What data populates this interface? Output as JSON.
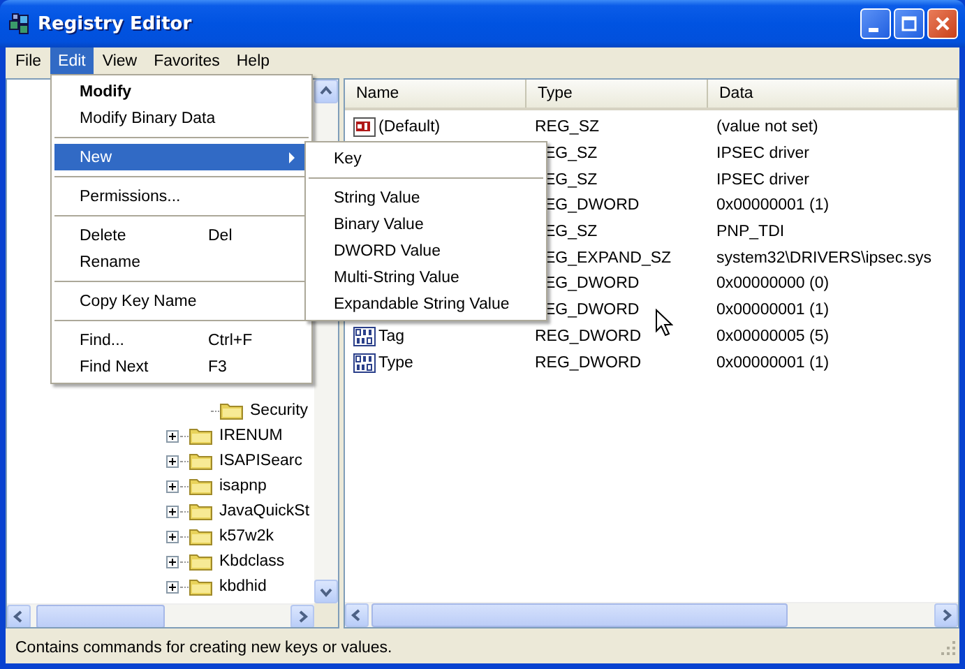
{
  "window": {
    "title": "Registry Editor"
  },
  "menu_bar": [
    {
      "label": "File",
      "selected": false
    },
    {
      "label": "Edit",
      "selected": true
    },
    {
      "label": "View",
      "selected": false
    },
    {
      "label": "Favorites",
      "selected": false
    },
    {
      "label": "Help",
      "selected": false
    }
  ],
  "edit_menu": [
    {
      "kind": "item",
      "label": "Modify",
      "default": true,
      "selected": false,
      "submenu": false
    },
    {
      "kind": "item",
      "label": "Modify Binary Data",
      "default": false,
      "selected": false,
      "submenu": false
    },
    {
      "kind": "separator"
    },
    {
      "kind": "item",
      "label": "New",
      "default": false,
      "selected": true,
      "submenu": true
    },
    {
      "kind": "separator"
    },
    {
      "kind": "item",
      "label": "Permissions...",
      "default": false,
      "selected": false,
      "submenu": false
    },
    {
      "kind": "separator"
    },
    {
      "kind": "item",
      "label": "Delete",
      "shortcut": "Del",
      "default": false,
      "selected": false,
      "submenu": false
    },
    {
      "kind": "item",
      "label": "Rename",
      "default": false,
      "selected": false,
      "submenu": false
    },
    {
      "kind": "separator"
    },
    {
      "kind": "item",
      "label": "Copy Key Name",
      "default": false,
      "selected": false,
      "submenu": false
    },
    {
      "kind": "separator"
    },
    {
      "kind": "item",
      "label": "Find...",
      "shortcut": "Ctrl+F",
      "default": false,
      "selected": false,
      "submenu": false
    },
    {
      "kind": "item",
      "label": "Find Next",
      "shortcut": "F3",
      "default": false,
      "selected": false,
      "submenu": false
    }
  ],
  "new_submenu": [
    {
      "kind": "item",
      "label": "Key"
    },
    {
      "kind": "separator"
    },
    {
      "kind": "item",
      "label": "String Value"
    },
    {
      "kind": "item",
      "label": "Binary Value"
    },
    {
      "kind": "item",
      "label": "DWORD Value"
    },
    {
      "kind": "item",
      "label": "Multi-String Value"
    },
    {
      "kind": "item",
      "label": "Expandable String Value"
    }
  ],
  "tree": {
    "open_branch_children": [
      {
        "label": "Security"
      }
    ],
    "items": [
      {
        "label": "IRENUM",
        "expanded": false
      },
      {
        "label": "ISAPISearc",
        "expanded": false
      },
      {
        "label": "isapnp",
        "expanded": false
      },
      {
        "label": "JavaQuickSt",
        "expanded": false
      },
      {
        "label": "k57w2k",
        "expanded": false
      },
      {
        "label": "Kbdclass",
        "expanded": false
      },
      {
        "label": "kbdhid",
        "expanded": false
      }
    ]
  },
  "values": {
    "columns": [
      "Name",
      "Type",
      "Data"
    ],
    "rows": [
      {
        "kind": "string",
        "name": "(Default)",
        "type": "REG_SZ",
        "data": "(value not set)"
      },
      {
        "type": "EG_SZ",
        "data": "IPSEC driver"
      },
      {
        "type": "EG_SZ",
        "data": "IPSEC driver"
      },
      {
        "type": "EG_DWORD",
        "data": "0x00000001 (1)"
      },
      {
        "type": "EG_SZ",
        "data": "PNP_TDI"
      },
      {
        "type": "EG_EXPAND_SZ",
        "data": "system32\\DRIVERS\\ipsec.sys"
      },
      {
        "type": "EG_DWORD",
        "data": "0x00000000 (0)"
      },
      {
        "type": "EG_DWORD",
        "data": "0x00000001 (1)"
      },
      {
        "kind": "binary",
        "name": "Tag",
        "type": "REG_DWORD",
        "data": "0x00000005 (5)"
      },
      {
        "kind": "binary",
        "name": "Type",
        "type": "REG_DWORD",
        "data": "0x00000001 (1)"
      }
    ]
  },
  "status_bar": "Contains commands for creating new keys or values."
}
